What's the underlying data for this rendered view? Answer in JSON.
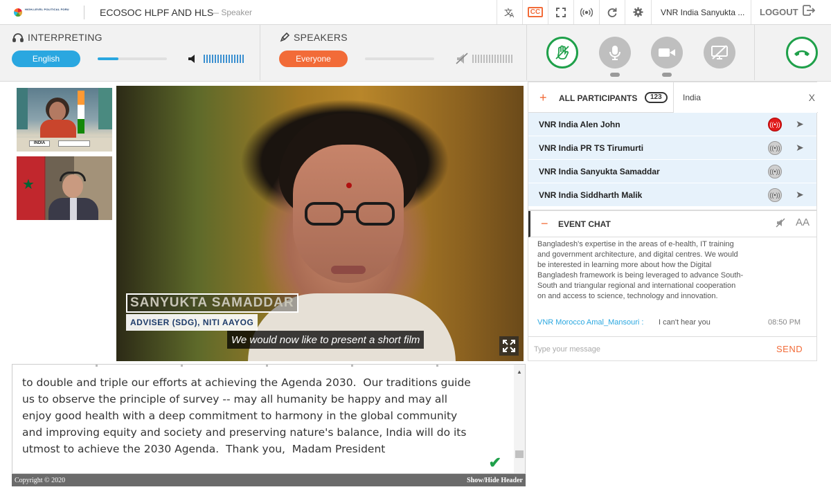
{
  "header": {
    "logo_text": "HIGH-LEVEL POLITICAL FORUM ON SUSTAINABLE DEVELOPMENT",
    "title": "ECOSOC HLPF AND HLS",
    "role": "— Speaker",
    "user_name": "VNR India Sanyukta ...",
    "logout_label": "LOGOUT",
    "cc_label": "CC"
  },
  "interpreting": {
    "title": "INTERPRETING",
    "language": "English",
    "volume": 0.3
  },
  "speakers": {
    "title": "SPEAKERS",
    "audience": "Everyone"
  },
  "video": {
    "name_overlay": "SANYUKTA SAMADDAR",
    "role_overlay": "ADVISER (SDG), NITI AAYOG",
    "subtitle": "We would now like to present a short film"
  },
  "thumbnails": {
    "india_plate": "INDIA"
  },
  "captions": {
    "text": "to double and triple our efforts at achieving the Agenda 2030.  Our traditions guide\nus to observe the principle of survey -- may all humanity be happy and may all\nenjoy good health with a deep commitment to harmony in the global community\nand improving equity and society and preserving nature's balance, India will do its\nutmost to achieve the 2030 Agenda.  Thank you,  Madam President",
    "copyright": "Copyright © 2020",
    "toggle_label": "Show/Hide Header"
  },
  "participants": {
    "title": "ALL PARTICIPANTS",
    "count": "123",
    "search_value": "India",
    "close_label": "X",
    "rows": [
      {
        "name": "VNR India Alen John"
      },
      {
        "name": "VNR India PR TS Tirumurti"
      },
      {
        "name": "VNR India Sanyukta Samaddar"
      },
      {
        "name": "VNR India Siddharth Malik"
      }
    ]
  },
  "chat": {
    "title": "EVENT CHAT",
    "font_label": "AA",
    "message": "Bangladesh's expertise in the areas of e-health, IT training and government architecture, and digital centres. We would be interested in learning more about how the Digital Bangladesh framework is being leveraged to advance South-South and triangular regional and international cooperation on and access to science, technology and innovation.",
    "last_from": "VNR Morocco Amal_Mansouri :",
    "last_body": "I can't hear you",
    "last_time": "08:50 PM",
    "input_placeholder": "Type your message",
    "send_label": "SEND"
  },
  "colors": {
    "accent_orange": "#f26b38",
    "accent_blue": "#2aa7e0",
    "accent_green": "#1fa04a",
    "live_red": "#e11b1b"
  }
}
